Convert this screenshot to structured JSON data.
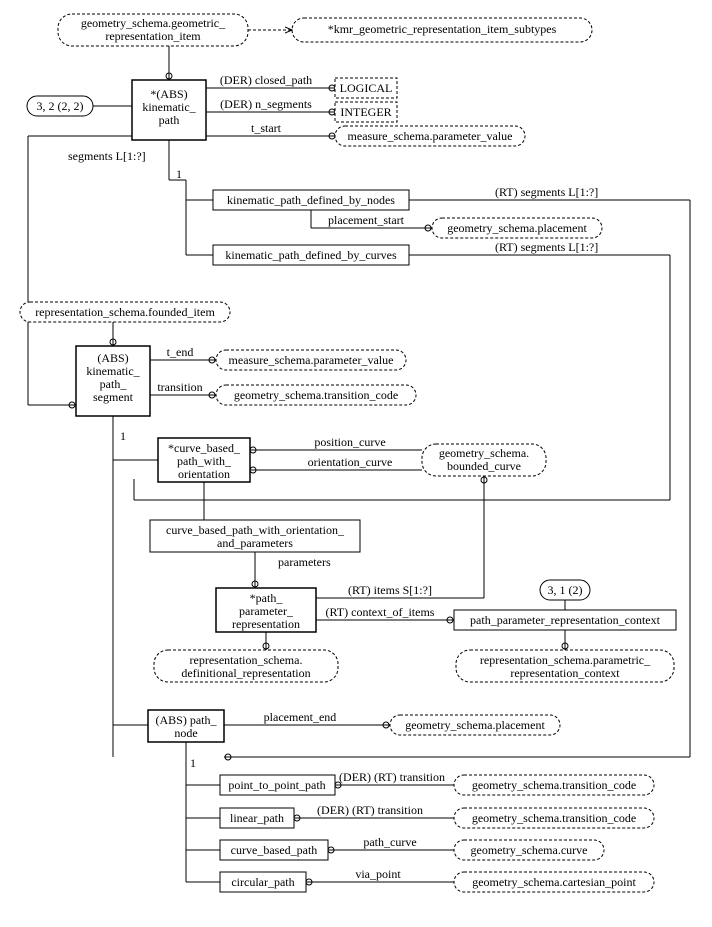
{
  "nodes": {
    "gri": "geometry_schema.geometric_\nrepresentation_item",
    "kmr": "*kmr_geometric_representation_item_subtypes",
    "badge1": "3, 2 (2, 2)",
    "abskp": "*(ABS)\nkinematic_\npath",
    "der_closed": "(DER) closed_path",
    "logical": "LOGICAL",
    "der_nseg": "(DER) n_segments",
    "integer": "INTEGER",
    "tstart": "t_start",
    "msv": "measure_schema.parameter_value",
    "segLabel": "segments L[1:?]",
    "one1": "1",
    "kpdn": "kinematic_path_defined_by_nodes",
    "rtseg1": "(RT) segments L[1:?]",
    "plstart": "placement_start",
    "gsp": "geometry_schema.placement",
    "kpdc": "kinematic_path_defined_by_curves",
    "rtseg2": "(RT) segments L[1:?]",
    "rsfi": "representation_schema.founded_item",
    "abskps": "(ABS)\nkinematic_\npath_\nsegment",
    "tend": "t_end",
    "msv2": "measure_schema.parameter_value",
    "transition": "transition",
    "gtc": "geometry_schema.transition_code",
    "one2": "1",
    "cbpwo": "*curve_based_\npath_with_\norientation",
    "poscurve": "position_curve",
    "orcurve": "orientation_curve",
    "gbc": "geometry_schema.\nbounded_curve",
    "cbpwoap": "curve_based_path_with_orientation_\nand_parameters",
    "params": "parameters",
    "ppr": "*path_\nparameter_\nrepresentation",
    "rtitems": "(RT) items S[1:?]",
    "rtctx": "(RT) context_of_items",
    "badge2": "3, 1 (2)",
    "pprc": "path_parameter_representation_context",
    "rsdr": "representation_schema.\ndefinitional_representation",
    "rsprc": "representation_schema.parametric_\nrepresentation_context",
    "abspn": "(ABS) path_\nnode",
    "plend": "placement_end",
    "gsp2": "geometry_schema.placement",
    "one3": "1",
    "p2p": "point_to_point_path",
    "derrt1": "(DER) (RT) transition",
    "gtc2": "geometry_schema.transition_code",
    "linp": "linear_path",
    "derrt2": "(DER) (RT) transition",
    "gtc3": "geometry_schema.transition_code",
    "cbp": "curve_based_path",
    "pathcurve": "path_curve",
    "gsc": "geometry_schema.curve",
    "circp": "circular_path",
    "viapt": "via_point",
    "gscp": "geometry_schema.cartesian_point"
  }
}
